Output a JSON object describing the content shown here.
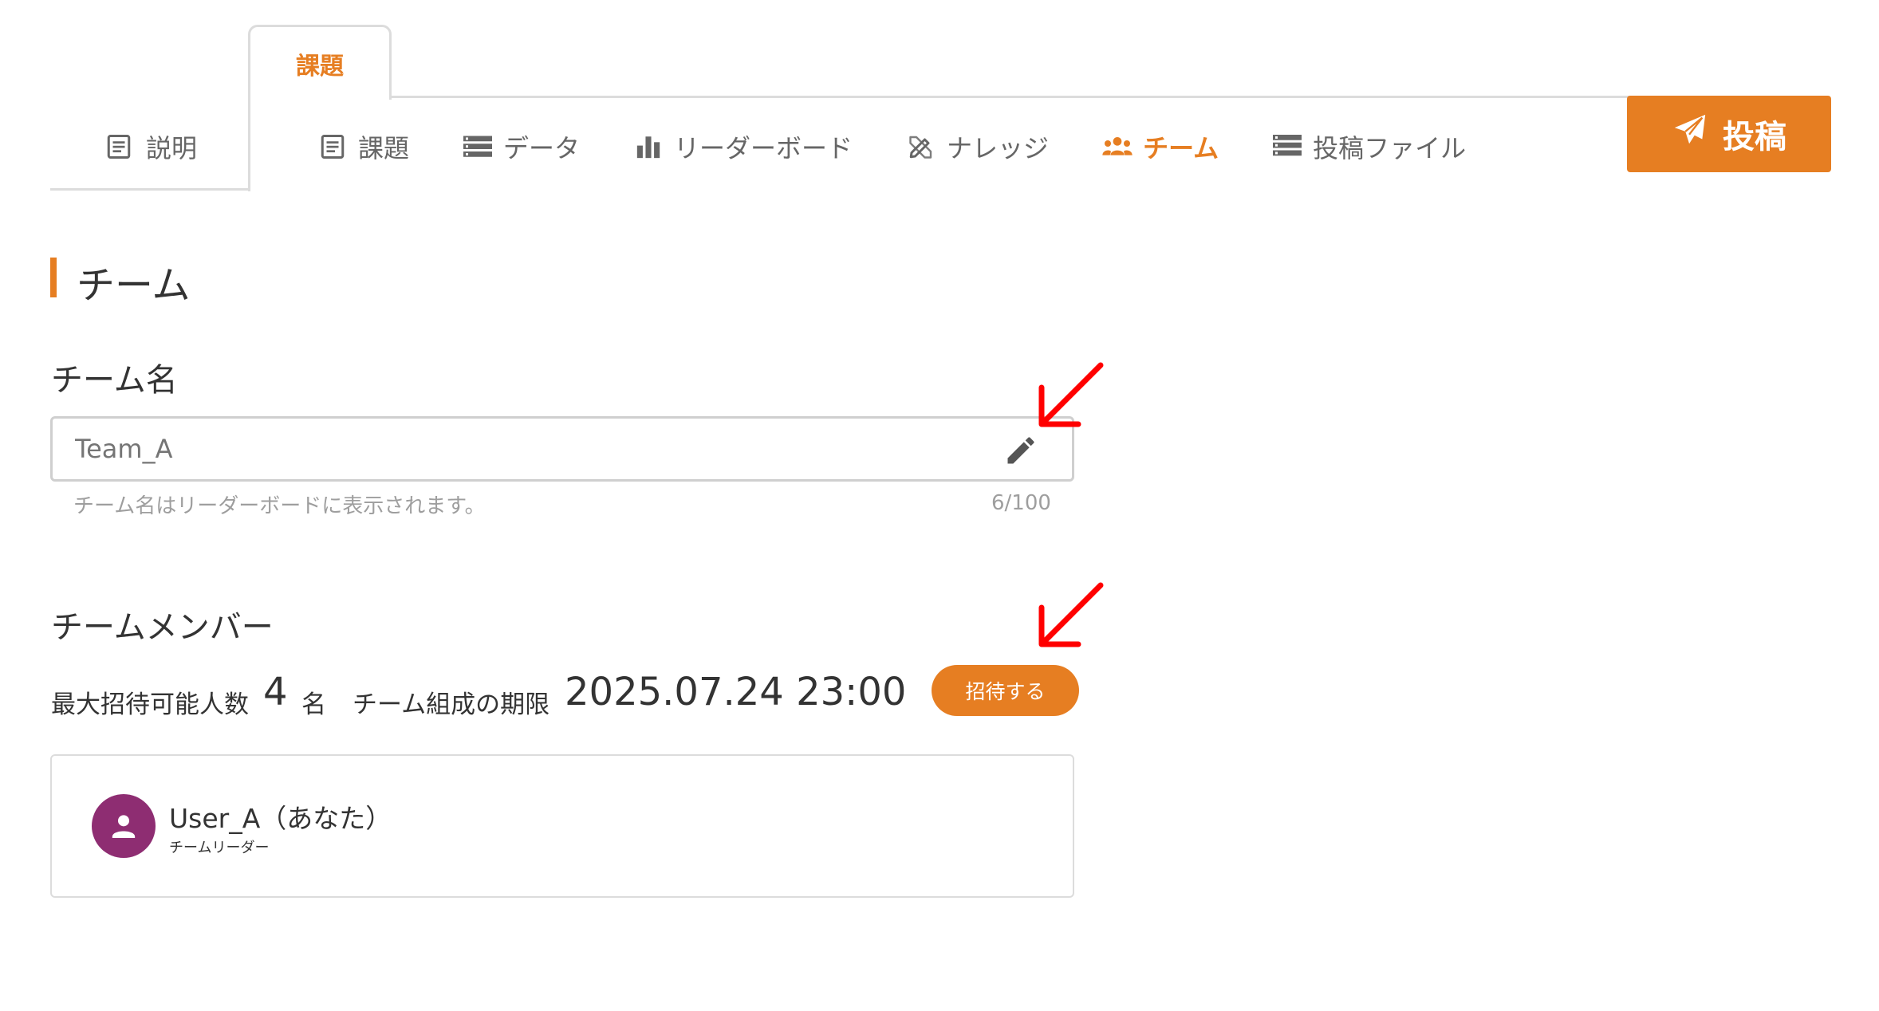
{
  "tabs": {
    "explain_label": "説明",
    "task_label": "課題"
  },
  "subnav": [
    {
      "label": "課題",
      "icon": "document-icon",
      "active": false
    },
    {
      "label": "データ",
      "icon": "database-icon",
      "active": false
    },
    {
      "label": "リーダーボード",
      "icon": "bar-chart-icon",
      "active": false
    },
    {
      "label": "ナレッジ",
      "icon": "pencil-ruler-icon",
      "active": false
    },
    {
      "label": "チーム",
      "icon": "users-icon",
      "active": true
    },
    {
      "label": "投稿ファイル",
      "icon": "server-list-icon",
      "active": false
    }
  ],
  "submit": {
    "label": "投稿",
    "icon": "paper-plane-icon"
  },
  "section": {
    "title": "チーム"
  },
  "team_name": {
    "label": "チーム名",
    "placeholder": "Team_A",
    "value": "",
    "hint": "チーム名はリーダーボードに表示されます。",
    "counter": "6/100"
  },
  "members": {
    "label": "チームメンバー",
    "max_label": "最大招待可能人数",
    "max_value": "4",
    "max_unit": "名",
    "deadline_label": "チーム組成の期限",
    "deadline_value": "2025.07.24 23:00",
    "invite_label": "招待する",
    "list": [
      {
        "name": "User_A（あなた）",
        "role": "チームリーダー"
      }
    ]
  },
  "colors": {
    "accent": "#e67e22",
    "avatar": "#8e2d72",
    "annotation_arrow": "#ff0000"
  }
}
